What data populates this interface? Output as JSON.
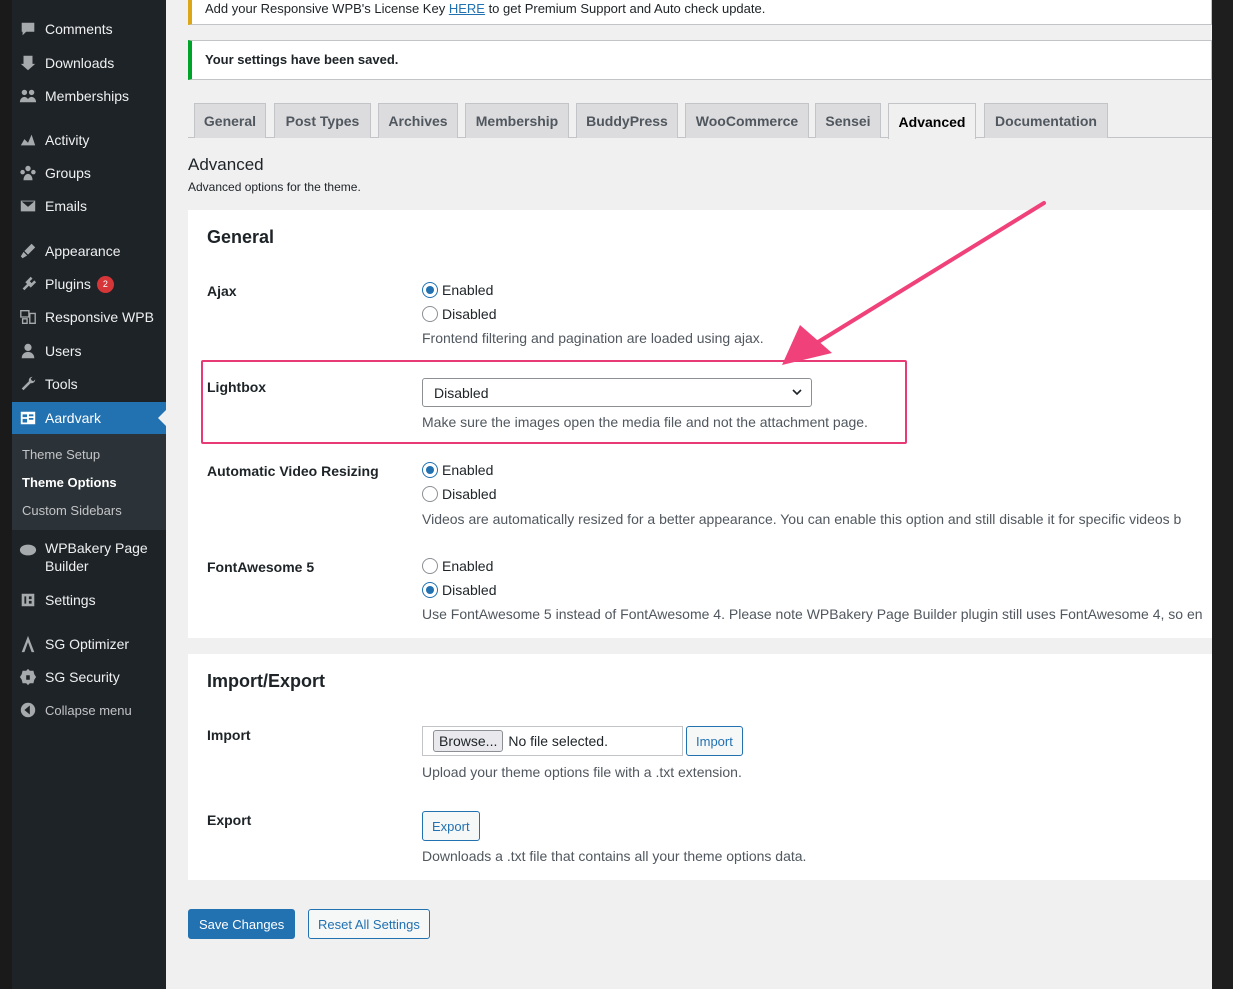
{
  "sidebar": {
    "items": [
      {
        "label": "Comments",
        "icon": "comments-icon"
      },
      {
        "label": "Downloads",
        "icon": "downloads-icon"
      },
      {
        "label": "Memberships",
        "icon": "memberships-icon"
      },
      {
        "label": "Activity",
        "icon": "activity-icon"
      },
      {
        "label": "Groups",
        "icon": "groups-icon"
      },
      {
        "label": "Emails",
        "icon": "emails-icon"
      },
      {
        "label": "Appearance",
        "icon": "appearance-icon"
      },
      {
        "label": "Plugins",
        "icon": "plugins-icon",
        "badge": "2"
      },
      {
        "label": "Responsive WPB",
        "icon": "responsive-wpb-icon"
      },
      {
        "label": "Users",
        "icon": "users-icon"
      },
      {
        "label": "Tools",
        "icon": "tools-icon"
      },
      {
        "label": "Aardvark",
        "icon": "aardvark-icon"
      },
      {
        "label": "WPBakery Page Builder",
        "icon": "wpbakery-icon"
      },
      {
        "label": "Settings",
        "icon": "settings-icon"
      },
      {
        "label": "SG Optimizer",
        "icon": "sg-optimizer-icon"
      },
      {
        "label": "SG Security",
        "icon": "sg-security-icon"
      },
      {
        "label": "Collapse menu",
        "icon": "collapse-icon"
      }
    ],
    "submenu": [
      "Theme Setup",
      "Theme Options",
      "Custom Sidebars"
    ]
  },
  "notices": {
    "license_prefix": "Add your Responsive WPB's License Key ",
    "license_link": "HERE",
    "license_suffix": " to get Premium Support and Auto check update.",
    "saved": "Your settings have been saved."
  },
  "tabs": [
    "General",
    "Post Types",
    "Archives",
    "Membership",
    "BuddyPress",
    "WooCommerce",
    "Sensei",
    "Advanced",
    "Documentation"
  ],
  "page": {
    "title": "Advanced",
    "subtitle": "Advanced options for the theme."
  },
  "general": {
    "title": "General",
    "ajax": {
      "label": "Ajax",
      "option_enabled": "Enabled",
      "option_disabled": "Disabled",
      "selected": "Enabled",
      "desc": "Frontend filtering and pagination are loaded using ajax."
    },
    "lightbox": {
      "label": "Lightbox",
      "value": "Disabled",
      "desc": "Make sure the images open the media file and not the attachment page."
    },
    "video": {
      "label": "Automatic Video Resizing",
      "option_enabled": "Enabled",
      "option_disabled": "Disabled",
      "selected": "Enabled",
      "desc": "Videos are automatically resized for a better appearance. You can enable this option and still disable it for specific videos b"
    },
    "fontawesome": {
      "label": "FontAwesome 5",
      "option_enabled": "Enabled",
      "option_disabled": "Disabled",
      "selected": "Disabled",
      "desc": "Use FontAwesome 5 instead of FontAwesome 4. Please note WPBakery Page Builder plugin still uses FontAwesome 4, so en"
    }
  },
  "import_export": {
    "title": "Import/Export",
    "import_label": "Import",
    "browse": "Browse...",
    "no_file": "No file selected.",
    "import_button": "Import",
    "import_desc": "Upload your theme options file with a .txt extension.",
    "export_label": "Export",
    "export_button": "Export",
    "export_desc": "Downloads a .txt file that contains all your theme options data."
  },
  "actions": {
    "save": "Save Changes",
    "reset": "Reset All Settings"
  },
  "colors": {
    "accent": "#2271b1",
    "highlight": "#e83a74",
    "sidebar_bg": "#1d2327"
  }
}
